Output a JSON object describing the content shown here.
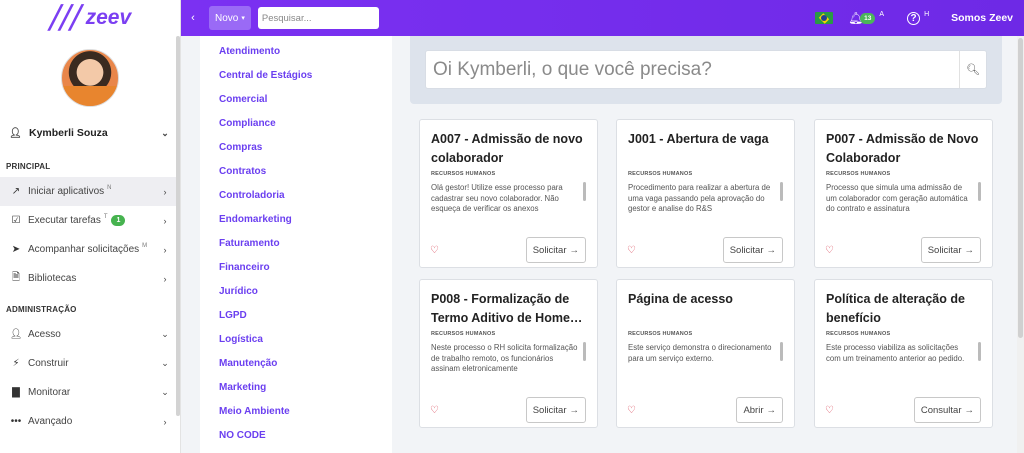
{
  "app": {
    "logo_text": "zeev"
  },
  "topbar": {
    "novo_label": "Novo",
    "search_placeholder": "Pesquisar...",
    "notification_count": "13",
    "notification_sup": "A",
    "help_sup": "H",
    "brand": "Somos Zeev"
  },
  "user": {
    "name": "Kymberli Souza"
  },
  "sidebar": {
    "section_principal": "PRINCIPAL",
    "section_admin": "ADMINISTRAÇÃO",
    "principal_items": [
      {
        "label": "Iniciar aplicativos",
        "sup": "N"
      },
      {
        "label": "Executar tarefas",
        "sup": "T",
        "badge": "1"
      },
      {
        "label": "Acompanhar solicitações",
        "sup": "M"
      },
      {
        "label": "Bibliotecas"
      }
    ],
    "admin_items": [
      {
        "label": "Acesso"
      },
      {
        "label": "Construir"
      },
      {
        "label": "Monitorar"
      },
      {
        "label": "Avançado"
      }
    ]
  },
  "categories": [
    "Atendimento",
    "Central de Estágios",
    "Comercial",
    "Compliance",
    "Compras",
    "Contratos",
    "Controladoria",
    "Endomarketing",
    "Faturamento",
    "Financeiro",
    "Jurídico",
    "LGPD",
    "Logística",
    "Manutenção",
    "Marketing",
    "Meio Ambiente",
    "NO CODE"
  ],
  "main": {
    "search_placeholder": "Oi Kymberli, o que você precisa?",
    "cards": [
      {
        "title": "A007 - Admissão de novo colaborador",
        "dept": "RECURSOS HUMANOS",
        "desc": "Olá gestor! Utilize esse processo para cadastrar seu novo colaborador. Não esqueça de verificar os anexos",
        "action": "Solicitar"
      },
      {
        "title": "J001 - Abertura de vaga",
        "dept": "RECURSOS HUMANOS",
        "desc": "Procedimento para realizar a abertura de uma vaga passando pela aprovação do gestor e analise do R&S",
        "action": "Solicitar"
      },
      {
        "title": "P007 - Admissão de Novo Colaborador",
        "dept": "RECURSOS HUMANOS",
        "desc": "Processo que simula uma admissão de um colaborador com geração automática do contrato e assinatura",
        "action": "Solicitar"
      },
      {
        "title": "P008 - Formalização de Termo Aditivo de Home…",
        "dept": "RECURSOS HUMANOS",
        "desc": "Neste processo o RH solicita formalização de trabalho remoto, os funcionários assinam eletronicamente",
        "action": "Solicitar"
      },
      {
        "title": "Página de acesso",
        "dept": "RECURSOS HUMANOS",
        "desc": "Este serviço demonstra o direcionamento para um serviço externo.",
        "action": "Abrir"
      },
      {
        "title": "Política de alteração de benefício",
        "dept": "RECURSOS HUMANOS",
        "desc": "Este processo viabiliza as solicitações com um treinamento anterior ao pedido.",
        "action": "Consultar"
      }
    ]
  }
}
